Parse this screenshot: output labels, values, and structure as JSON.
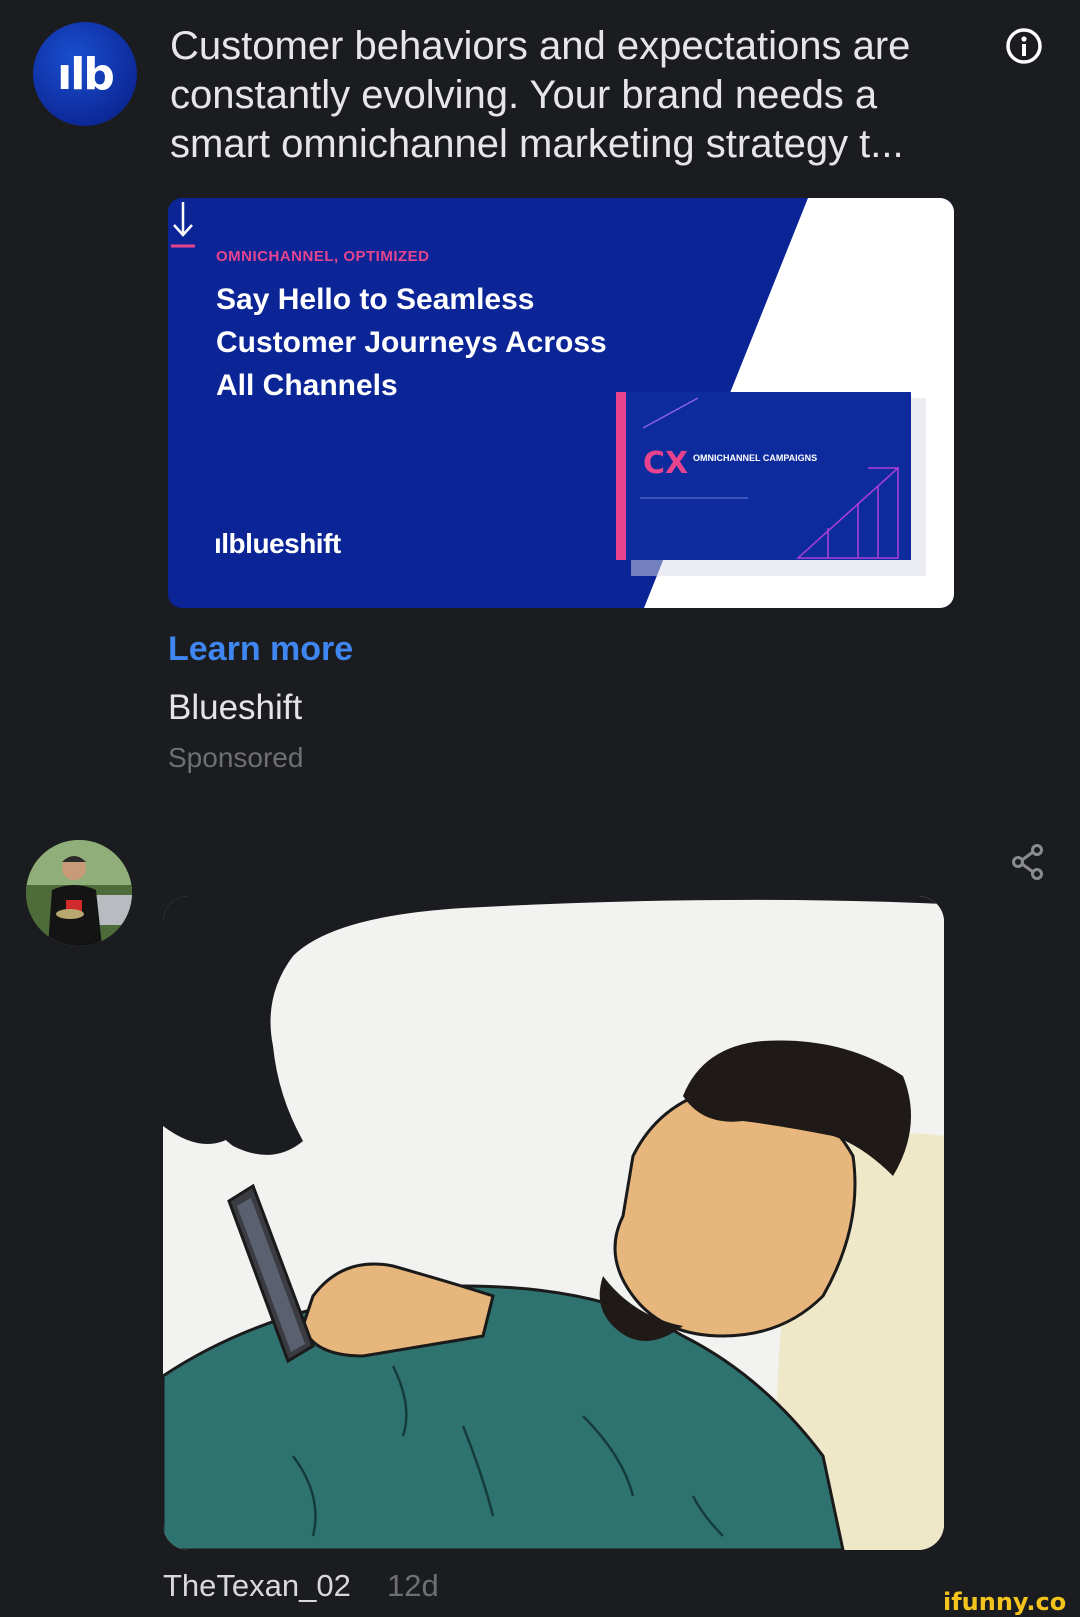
{
  "ad": {
    "avatar_text": "ılb",
    "text": "Customer behaviors and expectations are constantly evolving. Your brand needs a smart omnichannel marketing strategy t...",
    "banner": {
      "eyebrow": "OMNICHANNEL, OPTIMIZED",
      "headline": "Say Hello to Seamless Customer Journeys Across All Channels",
      "logo": "ılblueshift",
      "cx": "CX",
      "cx_sub": "OMNICHANNEL CAMPAIGNS"
    },
    "cta": "Learn more",
    "advertiser": "Blueshift",
    "sponsored": "Sponsored"
  },
  "post": {
    "user": "TheTexan_02",
    "time": "12d"
  },
  "watermark": "ifunny.co",
  "icons": [
    "info-icon",
    "download-arrow-icon",
    "share-icon"
  ],
  "colors": {
    "background": "#1b1c20",
    "link": "#3f86f0",
    "banner_blue": "#0b2596",
    "accent_pink": "#e8438f"
  }
}
